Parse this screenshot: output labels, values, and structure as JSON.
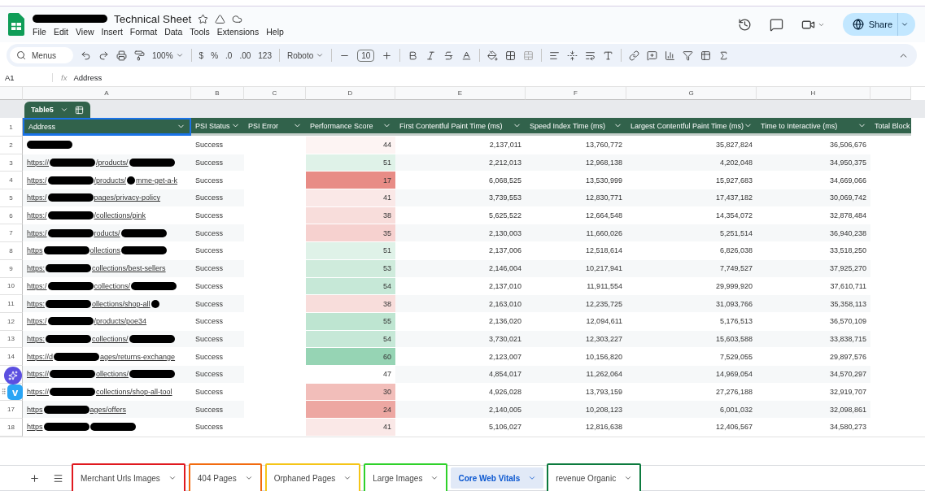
{
  "document": {
    "title": "Technical Sheet",
    "starred": false
  },
  "menu": [
    "File",
    "Edit",
    "View",
    "Insert",
    "Format",
    "Data",
    "Tools",
    "Extensions",
    "Help"
  ],
  "share": {
    "label": "Share"
  },
  "toolbar": {
    "search_placeholder": "Menus",
    "zoom": "100%",
    "currency": "$",
    "percent": "%",
    "decrease_decimals": ".0",
    "increase_decimals": ".00",
    "number_format": "123",
    "font": "Roboto",
    "font_size": "10"
  },
  "formula_bar": {
    "cell": "A1",
    "fx": "fx",
    "value": "Address"
  },
  "column_letters": [
    "A",
    "B",
    "C",
    "D",
    "E",
    "F",
    "G",
    "H"
  ],
  "table": {
    "name": "Table5",
    "header_row_number": "1",
    "columns": [
      {
        "label": "Address",
        "filter": true,
        "selected": true
      },
      {
        "label": "PSI Status",
        "filter": true,
        "selected": false
      },
      {
        "label": "PSI Error",
        "filter": true,
        "selected": false
      },
      {
        "label": "Performance Score",
        "filter": true,
        "selected": false
      },
      {
        "label": "First Contentful Paint Time (ms)",
        "filter": true,
        "selected": false
      },
      {
        "label": "Speed Index Time (ms)",
        "filter": true,
        "selected": false
      },
      {
        "label": "Largest Contentful Paint Time (ms)",
        "filter": true,
        "selected": false
      },
      {
        "label": "Time to Interactive (ms)",
        "filter": true,
        "selected": false
      },
      {
        "label": "Total Block",
        "selected": false
      }
    ],
    "rows": [
      {
        "num": "2",
        "address": [
          {
            "kind": "redacted"
          }
        ],
        "status": "Success",
        "score": "44",
        "fcp": "2,137,011",
        "si": "13,760,772",
        "lcp": "35,827,824",
        "tti": "36,506,676"
      },
      {
        "num": "3",
        "address": [
          {
            "kind": "text",
            "text": "https://"
          },
          {
            "kind": "redacted"
          },
          {
            "kind": "text",
            "text": "/products/"
          },
          {
            "kind": "redacted"
          }
        ],
        "status": "Success",
        "score": "51",
        "fcp": "2,212,013",
        "si": "12,968,138",
        "lcp": "4,202,048",
        "tti": "34,950,375"
      },
      {
        "num": "4",
        "address": [
          {
            "kind": "text",
            "text": "https:/"
          },
          {
            "kind": "redacted"
          },
          {
            "kind": "text",
            "text": "/products/"
          },
          {
            "kind": "dot"
          },
          {
            "kind": "text",
            "text": "mme-get-a-k"
          }
        ],
        "status": "Success",
        "score": "17",
        "fcp": "6,068,525",
        "si": "13,530,999",
        "lcp": "15,927,683",
        "tti": "34,669,066"
      },
      {
        "num": "5",
        "address": [
          {
            "kind": "text",
            "text": "https:/"
          },
          {
            "kind": "redacted"
          },
          {
            "kind": "text",
            "text": "pages/privacy-policy"
          }
        ],
        "status": "Success",
        "score": "41",
        "fcp": "3,739,553",
        "si": "12,830,771",
        "lcp": "17,437,182",
        "tti": "30,069,742"
      },
      {
        "num": "6",
        "address": [
          {
            "kind": "text",
            "text": "https:/"
          },
          {
            "kind": "redacted"
          },
          {
            "kind": "text",
            "text": "/collections/pink"
          }
        ],
        "status": "Success",
        "score": "38",
        "fcp": "5,625,522",
        "si": "12,664,548",
        "lcp": "14,354,072",
        "tti": "32,878,484"
      },
      {
        "num": "7",
        "address": [
          {
            "kind": "text",
            "text": "https:/"
          },
          {
            "kind": "redacted"
          },
          {
            "kind": "text",
            "text": "roducts/"
          },
          {
            "kind": "redacted"
          }
        ],
        "status": "Success",
        "score": "35",
        "fcp": "2,130,003",
        "si": "11,660,026",
        "lcp": "5,251,514",
        "tti": "36,940,238"
      },
      {
        "num": "8",
        "address": [
          {
            "kind": "text",
            "text": "https"
          },
          {
            "kind": "redacted"
          },
          {
            "kind": "text",
            "text": "ollections"
          },
          {
            "kind": "redacted"
          }
        ],
        "status": "Success",
        "score": "51",
        "fcp": "2,137,006",
        "si": "12,518,614",
        "lcp": "6,826,038",
        "tti": "33,518,250"
      },
      {
        "num": "9",
        "address": [
          {
            "kind": "text",
            "text": "https:"
          },
          {
            "kind": "redacted"
          },
          {
            "kind": "text",
            "text": "collections/best-sellers"
          }
        ],
        "status": "Success",
        "score": "53",
        "fcp": "2,146,004",
        "si": "10,217,941",
        "lcp": "7,749,527",
        "tti": "37,925,270"
      },
      {
        "num": "10",
        "address": [
          {
            "kind": "text",
            "text": "https:/"
          },
          {
            "kind": "redacted"
          },
          {
            "kind": "text",
            "text": "collections/"
          },
          {
            "kind": "redacted"
          }
        ],
        "status": "Success",
        "score": "54",
        "fcp": "2,137,010",
        "si": "11,911,554",
        "lcp": "29,999,920",
        "tti": "37,610,711"
      },
      {
        "num": "11",
        "address": [
          {
            "kind": "text",
            "text": "https:"
          },
          {
            "kind": "redacted"
          },
          {
            "kind": "text",
            "text": "ollections/shop-all"
          },
          {
            "kind": "dot"
          }
        ],
        "status": "Success",
        "score": "38",
        "fcp": "2,163,010",
        "si": "12,235,725",
        "lcp": "31,093,766",
        "tti": "35,358,113"
      },
      {
        "num": "12",
        "address": [
          {
            "kind": "text",
            "text": "https:/"
          },
          {
            "kind": "redacted"
          },
          {
            "kind": "text",
            "text": "/products/poe34"
          }
        ],
        "status": "Success",
        "score": "55",
        "fcp": "2,136,020",
        "si": "12,094,611",
        "lcp": "5,176,513",
        "tti": "36,570,109"
      },
      {
        "num": "13",
        "address": [
          {
            "kind": "text",
            "text": "https:"
          },
          {
            "kind": "redacted"
          },
          {
            "kind": "text",
            "text": "collections/"
          },
          {
            "kind": "redacted"
          }
        ],
        "status": "Success",
        "score": "54",
        "fcp": "3,730,021",
        "si": "12,303,227",
        "lcp": "15,603,588",
        "tti": "33,838,715"
      },
      {
        "num": "14",
        "address": [
          {
            "kind": "text",
            "text": "https://d"
          },
          {
            "kind": "redacted"
          },
          {
            "kind": "text",
            "text": "ages/returns-exchange"
          }
        ],
        "status": "Success",
        "score": "60",
        "fcp": "2,123,007",
        "si": "10,156,820",
        "lcp": "7,529,055",
        "tti": "29,897,576"
      },
      {
        "address": [
          {
            "kind": "text",
            "text": "https://"
          },
          {
            "kind": "redacted"
          },
          {
            "kind": "text",
            "text": "ollections/"
          },
          {
            "kind": "redacted"
          }
        ],
        "status": "Success",
        "score": "47",
        "fcp": "4,854,017",
        "si": "11,262,064",
        "lcp": "14,969,054",
        "tti": "34,570,297"
      },
      {
        "address": [
          {
            "kind": "text",
            "text": "https://"
          },
          {
            "kind": "redacted"
          },
          {
            "kind": "text",
            "text": "collections/shop-all-tool"
          }
        ],
        "status": "Success",
        "score": "30",
        "fcp": "4,926,028",
        "si": "13,793,159",
        "lcp": "27,276,188",
        "tti": "32,919,707"
      },
      {
        "num": "17",
        "address": [
          {
            "kind": "text",
            "text": "https"
          },
          {
            "kind": "redacted"
          },
          {
            "kind": "text",
            "text": "ages/offers"
          }
        ],
        "status": "Success",
        "score": "24",
        "fcp": "2,140,005",
        "si": "10,208,123",
        "lcp": "6,001,032",
        "tti": "32,098,861"
      },
      {
        "num": "18",
        "address": [
          {
            "kind": "text",
            "text": "https"
          },
          {
            "kind": "redacted"
          },
          {
            "kind": "redacted"
          }
        ],
        "status": "Success",
        "score": "41",
        "fcp": "5,106,027",
        "si": "12,816,638",
        "lcp": "12,406,567",
        "tti": "34,580,273"
      }
    ]
  },
  "widget": {
    "badge": "v"
  },
  "sheet_tabs": [
    {
      "label": "Merchant Urls Images",
      "selected": false,
      "color": "#e0191f"
    },
    {
      "label": "404 Pages",
      "selected": false,
      "color": "#f26b0f"
    },
    {
      "label": "Orphaned Pages",
      "selected": false,
      "color": "#f5c518"
    },
    {
      "label": "Large Images",
      "selected": false,
      "color": "#2fd12a"
    },
    {
      "label": "Core Web Vitals",
      "selected": true
    },
    {
      "label": "revenue Organic",
      "selected": false,
      "color": "#0c7a3e"
    }
  ]
}
